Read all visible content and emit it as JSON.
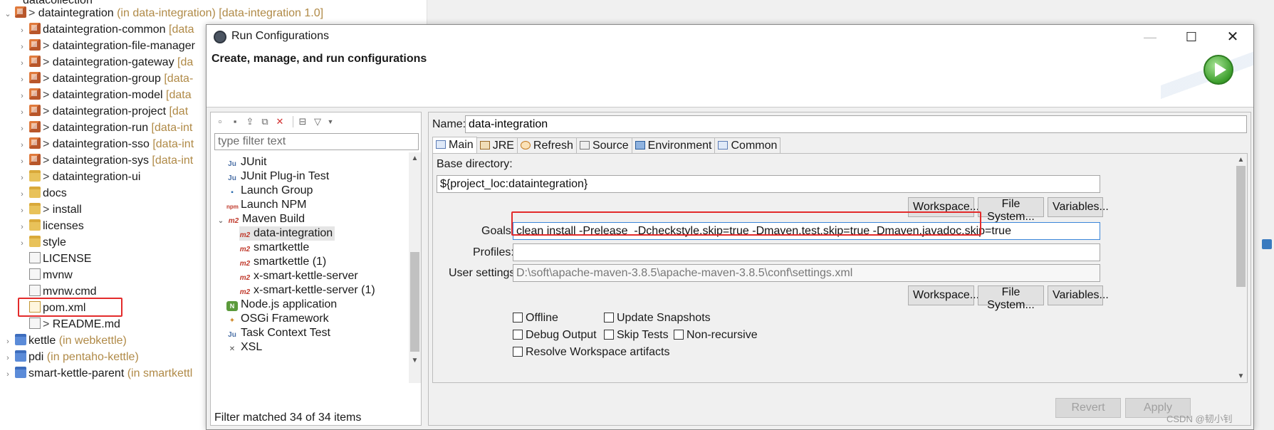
{
  "explorer": {
    "rows": [
      {
        "text": "datacollection"
      },
      {
        "prefix": "> ",
        "text": "dataintegration",
        "dec": " (in data-integration) [data-integration 1.0]"
      },
      {
        "text": "dataintegration-common",
        "dec": " [data"
      },
      {
        "prefix": "> ",
        "text": "dataintegration-file-manager"
      },
      {
        "prefix": "> ",
        "text": "dataintegration-gateway",
        "dec": " [da"
      },
      {
        "prefix": "> ",
        "text": "dataintegration-group",
        "dec": " [data-"
      },
      {
        "prefix": "> ",
        "text": "dataintegration-model",
        "dec": " [data"
      },
      {
        "prefix": "> ",
        "text": "dataintegration-project",
        "dec": " [dat"
      },
      {
        "prefix": "> ",
        "text": "dataintegration-run",
        "dec": " [data-int"
      },
      {
        "prefix": "> ",
        "text": "dataintegration-sso",
        "dec": " [data-int"
      },
      {
        "prefix": "> ",
        "text": "dataintegration-sys",
        "dec": " [data-int"
      },
      {
        "prefix": "> ",
        "text": "dataintegration-ui"
      },
      {
        "text": "docs"
      },
      {
        "prefix": "> ",
        "text": "install"
      },
      {
        "text": "licenses"
      },
      {
        "text": "style"
      },
      {
        "text": "LICENSE"
      },
      {
        "text": "mvnw"
      },
      {
        "text": "mvnw.cmd"
      },
      {
        "text": "pom.xml"
      },
      {
        "prefix": "> ",
        "text": "README.md"
      },
      {
        "text": "kettle",
        "dec": " (in webkettle)"
      },
      {
        "text": "pdi",
        "dec": " (in pentaho-kettle)"
      },
      {
        "text": "smart-kettle-parent",
        "dec": " (in smartkettl"
      }
    ]
  },
  "dialog": {
    "title": "Run Configurations",
    "heading": "Create, manage, and run configurations",
    "filter_placeholder": "type filter text",
    "filter_status": "Filter matched 34 of 34 items",
    "config_tree": [
      {
        "label": "JUnit",
        "icon": "Ju"
      },
      {
        "label": "JUnit Plug-in Test",
        "icon": "Ju"
      },
      {
        "label": "Launch Group",
        "icon": "lg"
      },
      {
        "label": "Launch NPM",
        "icon": "npm"
      },
      {
        "label": "Maven Build",
        "icon": "m2"
      },
      {
        "label": "data-integration",
        "icon": "m2"
      },
      {
        "label": "smartkettle",
        "icon": "m2"
      },
      {
        "label": "smartkettle (1)",
        "icon": "m2"
      },
      {
        "label": "x-smart-kettle-server",
        "icon": "m2"
      },
      {
        "label": "x-smart-kettle-server (1)",
        "icon": "m2"
      },
      {
        "label": "Node.js application",
        "icon": "node"
      },
      {
        "label": "OSGi Framework",
        "icon": "osgi"
      },
      {
        "label": "Task Context Test",
        "icon": "Ju"
      },
      {
        "label": "XSL",
        "icon": "xsl"
      }
    ],
    "name_label": "Name:",
    "name_value": "data-integration",
    "tabs": [
      "Main",
      "JRE",
      "Refresh",
      "Source",
      "Environment",
      "Common"
    ],
    "main": {
      "base_dir_label": "Base directory:",
      "base_dir_value": "${project_loc:dataintegration}",
      "workspace_btn": "Workspace...",
      "filesystem_btn": "File System...",
      "variables_btn": "Variables...",
      "goals_label": "Goals:",
      "goals_value": "clean install -Prelease  -Dcheckstyle.skip=true -Dmaven.test.skip=true -Dmaven.javadoc.skip=true",
      "profiles_label": "Profiles:",
      "profiles_value": "",
      "user_settings_label": "User settings:",
      "user_settings_value": "D:\\soft\\apache-maven-3.8.5\\apache-maven-3.8.5\\conf\\settings.xml",
      "checkboxes": {
        "offline": "Offline",
        "update_snapshots": "Update Snapshots",
        "debug_output": "Debug Output",
        "skip_tests": "Skip Tests",
        "non_recursive": "Non-recursive",
        "resolve_workspace": "Resolve Workspace artifacts"
      }
    },
    "revert_btn": "Revert",
    "apply_btn": "Apply"
  },
  "watermark": "CSDN @韧小钊"
}
